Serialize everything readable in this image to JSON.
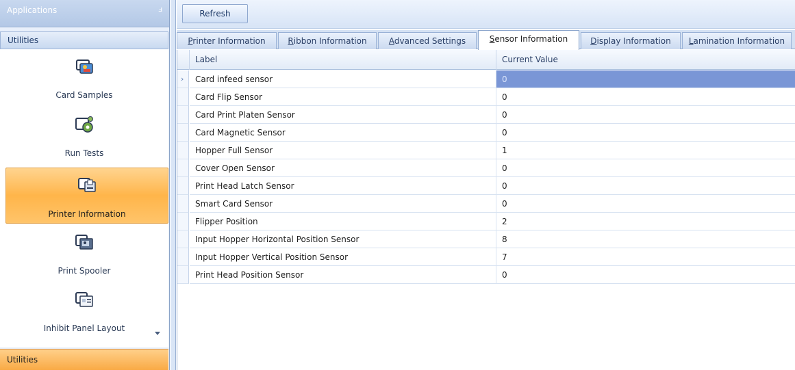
{
  "nav": {
    "title": "Applications",
    "pin_glyph": "ⅎ",
    "group_top": "Utilities",
    "group_bottom": "Utilities",
    "items": [
      {
        "label": "Card Samples",
        "icon": "card-samples-icon"
      },
      {
        "label": "Run Tests",
        "icon": "run-tests-gear-icon"
      },
      {
        "label": "Printer Information",
        "icon": "printer-information-icon"
      },
      {
        "label": "Print Spooler",
        "icon": "print-spooler-icon"
      },
      {
        "label": "Inhibit Panel Layout",
        "icon": "inhibit-panel-layout-icon"
      }
    ],
    "selected_index": 2
  },
  "toolbar": {
    "refresh_label": "Refresh"
  },
  "tabs": [
    {
      "label": "Printer Information",
      "accel": "P"
    },
    {
      "label": "Ribbon Information",
      "accel": "R"
    },
    {
      "label": "Advanced Settings",
      "accel": "A"
    },
    {
      "label": "Sensor Information",
      "accel": "S",
      "active": true
    },
    {
      "label": "Display Information",
      "accel": "D"
    },
    {
      "label": "Lamination Information",
      "accel": "L"
    }
  ],
  "grid": {
    "columns": [
      "Label",
      "Current Value"
    ],
    "rows": [
      {
        "label": "Card infeed sensor",
        "value": "0"
      },
      {
        "label": "Card Flip Sensor",
        "value": "0"
      },
      {
        "label": "Card Print Platen Sensor",
        "value": "0"
      },
      {
        "label": "Card Magnetic Sensor",
        "value": "0"
      },
      {
        "label": "Hopper Full Sensor",
        "value": "1"
      },
      {
        "label": "Cover Open Sensor",
        "value": "0"
      },
      {
        "label": "Print Head Latch Sensor",
        "value": "0"
      },
      {
        "label": "Smart Card Sensor",
        "value": "0"
      },
      {
        "label": "Flipper Position",
        "value": "2"
      },
      {
        "label": "Input Hopper Horizontal Position Sensor",
        "value": "8"
      },
      {
        "label": "Input Hopper Vertical Position Sensor",
        "value": "7"
      },
      {
        "label": "Print Head Position Sensor",
        "value": "0"
      }
    ],
    "current_row_glyph": "›"
  },
  "colors": {
    "selection": "#7a96d6",
    "selected_nav": "#ffb54a",
    "accent": "#1e3a68"
  }
}
